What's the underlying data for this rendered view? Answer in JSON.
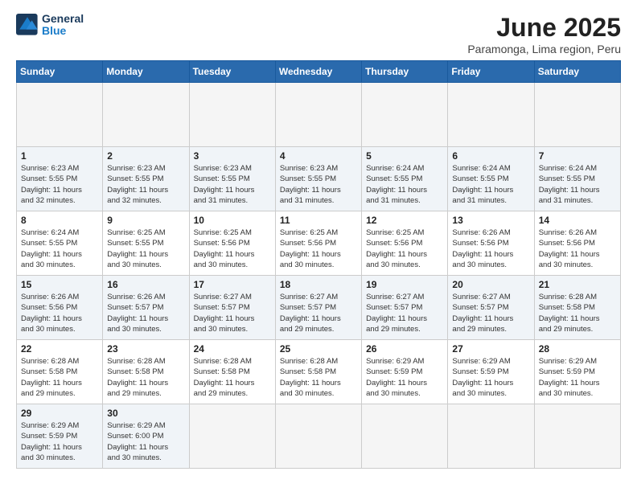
{
  "header": {
    "logo_line1": "General",
    "logo_line2": "Blue",
    "title": "June 2025",
    "subtitle": "Paramonga, Lima region, Peru"
  },
  "calendar": {
    "weekdays": [
      "Sunday",
      "Monday",
      "Tuesday",
      "Wednesday",
      "Thursday",
      "Friday",
      "Saturday"
    ],
    "weeks": [
      [
        {
          "day": null,
          "info": null
        },
        {
          "day": null,
          "info": null
        },
        {
          "day": null,
          "info": null
        },
        {
          "day": null,
          "info": null
        },
        {
          "day": null,
          "info": null
        },
        {
          "day": null,
          "info": null
        },
        {
          "day": null,
          "info": null
        }
      ],
      [
        {
          "day": "1",
          "info": "Sunrise: 6:23 AM\nSunset: 5:55 PM\nDaylight: 11 hours\nand 32 minutes."
        },
        {
          "day": "2",
          "info": "Sunrise: 6:23 AM\nSunset: 5:55 PM\nDaylight: 11 hours\nand 32 minutes."
        },
        {
          "day": "3",
          "info": "Sunrise: 6:23 AM\nSunset: 5:55 PM\nDaylight: 11 hours\nand 31 minutes."
        },
        {
          "day": "4",
          "info": "Sunrise: 6:23 AM\nSunset: 5:55 PM\nDaylight: 11 hours\nand 31 minutes."
        },
        {
          "day": "5",
          "info": "Sunrise: 6:24 AM\nSunset: 5:55 PM\nDaylight: 11 hours\nand 31 minutes."
        },
        {
          "day": "6",
          "info": "Sunrise: 6:24 AM\nSunset: 5:55 PM\nDaylight: 11 hours\nand 31 minutes."
        },
        {
          "day": "7",
          "info": "Sunrise: 6:24 AM\nSunset: 5:55 PM\nDaylight: 11 hours\nand 31 minutes."
        }
      ],
      [
        {
          "day": "8",
          "info": "Sunrise: 6:24 AM\nSunset: 5:55 PM\nDaylight: 11 hours\nand 30 minutes."
        },
        {
          "day": "9",
          "info": "Sunrise: 6:25 AM\nSunset: 5:55 PM\nDaylight: 11 hours\nand 30 minutes."
        },
        {
          "day": "10",
          "info": "Sunrise: 6:25 AM\nSunset: 5:56 PM\nDaylight: 11 hours\nand 30 minutes."
        },
        {
          "day": "11",
          "info": "Sunrise: 6:25 AM\nSunset: 5:56 PM\nDaylight: 11 hours\nand 30 minutes."
        },
        {
          "day": "12",
          "info": "Sunrise: 6:25 AM\nSunset: 5:56 PM\nDaylight: 11 hours\nand 30 minutes."
        },
        {
          "day": "13",
          "info": "Sunrise: 6:26 AM\nSunset: 5:56 PM\nDaylight: 11 hours\nand 30 minutes."
        },
        {
          "day": "14",
          "info": "Sunrise: 6:26 AM\nSunset: 5:56 PM\nDaylight: 11 hours\nand 30 minutes."
        }
      ],
      [
        {
          "day": "15",
          "info": "Sunrise: 6:26 AM\nSunset: 5:56 PM\nDaylight: 11 hours\nand 30 minutes."
        },
        {
          "day": "16",
          "info": "Sunrise: 6:26 AM\nSunset: 5:57 PM\nDaylight: 11 hours\nand 30 minutes."
        },
        {
          "day": "17",
          "info": "Sunrise: 6:27 AM\nSunset: 5:57 PM\nDaylight: 11 hours\nand 30 minutes."
        },
        {
          "day": "18",
          "info": "Sunrise: 6:27 AM\nSunset: 5:57 PM\nDaylight: 11 hours\nand 29 minutes."
        },
        {
          "day": "19",
          "info": "Sunrise: 6:27 AM\nSunset: 5:57 PM\nDaylight: 11 hours\nand 29 minutes."
        },
        {
          "day": "20",
          "info": "Sunrise: 6:27 AM\nSunset: 5:57 PM\nDaylight: 11 hours\nand 29 minutes."
        },
        {
          "day": "21",
          "info": "Sunrise: 6:28 AM\nSunset: 5:58 PM\nDaylight: 11 hours\nand 29 minutes."
        }
      ],
      [
        {
          "day": "22",
          "info": "Sunrise: 6:28 AM\nSunset: 5:58 PM\nDaylight: 11 hours\nand 29 minutes."
        },
        {
          "day": "23",
          "info": "Sunrise: 6:28 AM\nSunset: 5:58 PM\nDaylight: 11 hours\nand 29 minutes."
        },
        {
          "day": "24",
          "info": "Sunrise: 6:28 AM\nSunset: 5:58 PM\nDaylight: 11 hours\nand 29 minutes."
        },
        {
          "day": "25",
          "info": "Sunrise: 6:28 AM\nSunset: 5:58 PM\nDaylight: 11 hours\nand 30 minutes."
        },
        {
          "day": "26",
          "info": "Sunrise: 6:29 AM\nSunset: 5:59 PM\nDaylight: 11 hours\nand 30 minutes."
        },
        {
          "day": "27",
          "info": "Sunrise: 6:29 AM\nSunset: 5:59 PM\nDaylight: 11 hours\nand 30 minutes."
        },
        {
          "day": "28",
          "info": "Sunrise: 6:29 AM\nSunset: 5:59 PM\nDaylight: 11 hours\nand 30 minutes."
        }
      ],
      [
        {
          "day": "29",
          "info": "Sunrise: 6:29 AM\nSunset: 5:59 PM\nDaylight: 11 hours\nand 30 minutes."
        },
        {
          "day": "30",
          "info": "Sunrise: 6:29 AM\nSunset: 6:00 PM\nDaylight: 11 hours\nand 30 minutes."
        },
        {
          "day": null,
          "info": null
        },
        {
          "day": null,
          "info": null
        },
        {
          "day": null,
          "info": null
        },
        {
          "day": null,
          "info": null
        },
        {
          "day": null,
          "info": null
        }
      ]
    ]
  }
}
